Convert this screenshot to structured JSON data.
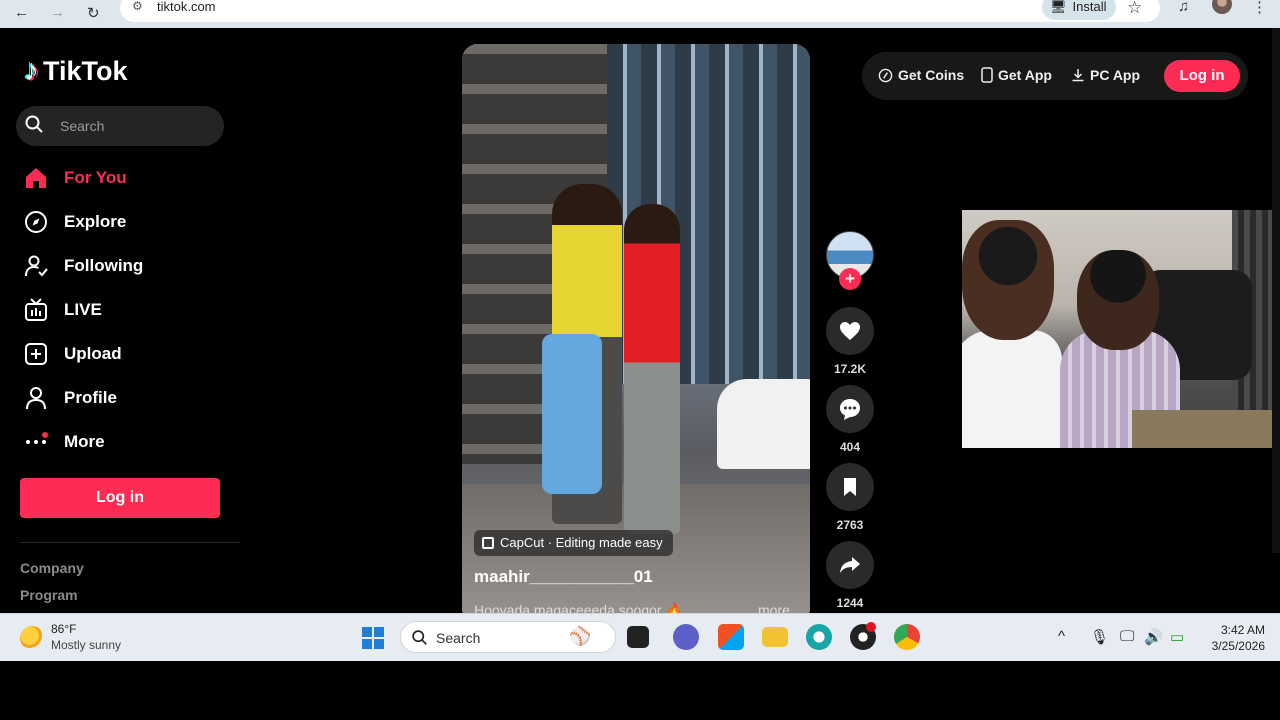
{
  "browser": {
    "url": "tiktok.com",
    "install_label": "Install"
  },
  "sidebar": {
    "logo_text": "TikTok",
    "search_placeholder": "Search",
    "items": [
      {
        "label": "For You",
        "icon": "home-icon",
        "active": true
      },
      {
        "label": "Explore",
        "icon": "compass-icon"
      },
      {
        "label": "Following",
        "icon": "following-icon"
      },
      {
        "label": "LIVE",
        "icon": "live-tv-icon"
      },
      {
        "label": "Upload",
        "icon": "upload-plus-icon"
      },
      {
        "label": "Profile",
        "icon": "person-icon"
      },
      {
        "label": "More",
        "icon": "more-dots-icon"
      }
    ],
    "login_label": "Log in",
    "footer_links": [
      "Company",
      "Program"
    ]
  },
  "video": {
    "effect_label": "CapCut · Editing made easy",
    "author": "maahir___________01",
    "description": "Hooyada magaceeeda sooqor 🔥",
    "more_label": "more"
  },
  "actions": {
    "likes": "17.2K",
    "comments": "404",
    "saves": "2763",
    "shares": "1244"
  },
  "top_actions": {
    "get_coins": "Get Coins",
    "get_app": "Get App",
    "pc_app": "PC App",
    "login": "Log in"
  },
  "taskbar": {
    "temperature": "86°F",
    "condition": "Mostly sunny",
    "search_label": "Search",
    "time": "3:42 AM",
    "date": "3/25/2026"
  },
  "colors": {
    "accent": "#fe2c55",
    "background": "#000000"
  }
}
